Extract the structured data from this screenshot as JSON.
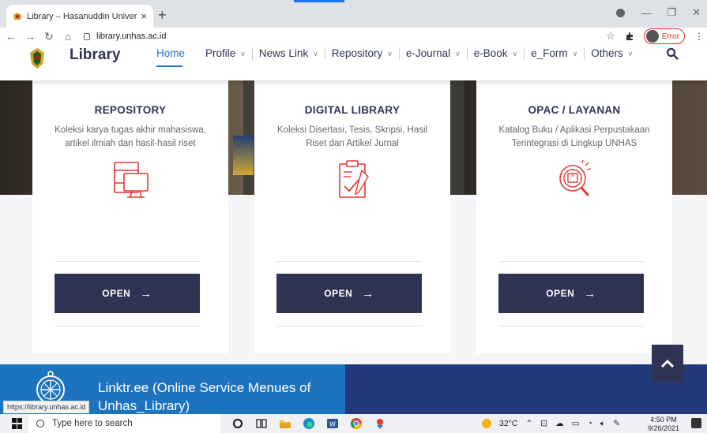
{
  "browser": {
    "tab_title": "Library – Hasanuddin University",
    "tab_close": "×",
    "new_tab": "+",
    "url": "library.unhas.ac.id",
    "profile_error": "Error",
    "status_url": "https://library.unhas.ac.id"
  },
  "site": {
    "brand": "Library",
    "menu": [
      {
        "label": "Home"
      },
      {
        "label": "Profile",
        "caret": "∨"
      },
      {
        "label": "News Link",
        "caret": "∨"
      },
      {
        "label": "Repository",
        "caret": "∨"
      },
      {
        "label": "e-Journal",
        "caret": "∨"
      },
      {
        "label": "e-Book",
        "caret": "∨"
      },
      {
        "label": "e_Form",
        "caret": "∨"
      },
      {
        "label": "Others",
        "caret": "∨"
      }
    ]
  },
  "cards": [
    {
      "title": "REPOSITORY",
      "desc": "Koleksi karya tugas akhir mahasiswa, artikel ilmiah dan hasil-hasil riset",
      "button": "OPEN",
      "arrow": "→",
      "icon": "computer-monitor-icon"
    },
    {
      "title": "DIGITAL LIBRARY",
      "desc": "Koleksi Disertasi, Tesis, Skripsi, Hasil Riset dan Artikel Jurnal",
      "button": "OPEN",
      "arrow": "→",
      "icon": "clipboard-check-icon"
    },
    {
      "title": "OPAC / LAYANAN",
      "desc": "Katalog Buku / Aplikasi Perpustakaan Terintegrasi di Lingkup UNHAS",
      "button": "OPEN",
      "arrow": "→",
      "icon": "search-box-icon"
    }
  ],
  "footer": {
    "text": "Linktr.ee (Online Service Menues of Unhas_Library)"
  },
  "taskbar": {
    "search_placeholder": "Type here to search",
    "temperature": "32°C",
    "time": "4:50 PM",
    "date": "9/26/2021"
  },
  "colors": {
    "primary": "#2f3454",
    "accent": "#e53935",
    "link": "#1e73be",
    "footer_blue": "#1e73be",
    "footer_dark": "#223a7c"
  }
}
